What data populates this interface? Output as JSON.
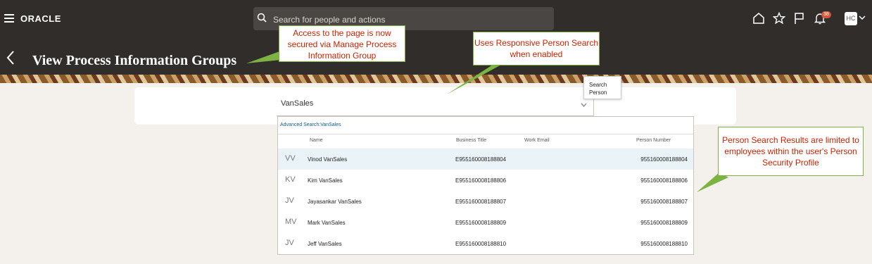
{
  "app": {
    "brand": "ORACLE",
    "search_placeholder": "Search for people and actions",
    "notifications_count": "38",
    "avatar_initials": "HC"
  },
  "page": {
    "title": "View Process Information Groups"
  },
  "callouts": {
    "access": "Access to the page is now secured via Manage Process Information Group",
    "responsive": "Uses Responsive Person Search when enabled",
    "results": "Person Search Results are limited to employees within the user's Person Security Profile"
  },
  "person_search": {
    "value": "VanSales",
    "tooltip": [
      "Search",
      "Person"
    ],
    "advanced_link": "Advanced Search:VanSales",
    "columns": [
      "Name",
      "Business Title",
      "Work Email",
      "Person Number"
    ],
    "rows": [
      {
        "initials": "VV",
        "name": "Vinod VanSales",
        "title": "E955160008188804",
        "email": "",
        "number": "955160008188804"
      },
      {
        "initials": "KV",
        "name": "Kim VanSales",
        "title": "E955160008188806",
        "email": "",
        "number": "955160008188806"
      },
      {
        "initials": "JV",
        "name": "Jayasankar VanSales",
        "title": "E955160008188807",
        "email": "",
        "number": "955160008188807"
      },
      {
        "initials": "MV",
        "name": "Mark VanSales",
        "title": "E955160008188809",
        "email": "",
        "number": "955160008188809"
      },
      {
        "initials": "JV",
        "name": "Jeff VanSales",
        "title": "E955160008188810",
        "email": "",
        "number": "955160008188810"
      }
    ]
  },
  "colors": {
    "header": "#312d2a",
    "callout_text": "#cc2200",
    "callout_border": "#7cb342",
    "link": "#0b5b8a"
  }
}
